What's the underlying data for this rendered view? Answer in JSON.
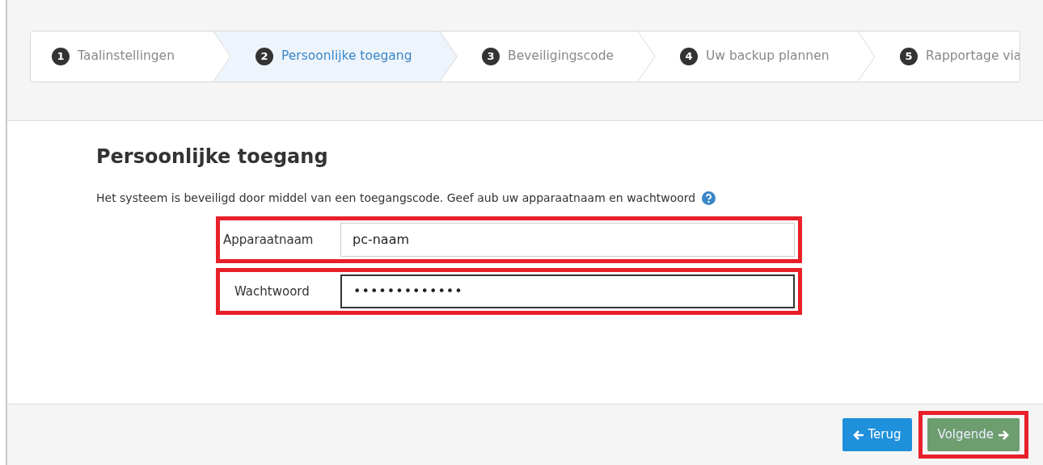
{
  "steps": [
    {
      "number": "1",
      "label": "Taalinstellingen",
      "selected": false
    },
    {
      "number": "2",
      "label": "Persoonlijke toegang",
      "selected": true
    },
    {
      "number": "3",
      "label": "Beveiligingscode",
      "selected": false
    },
    {
      "number": "4",
      "label": "Uw backup plannen",
      "selected": false
    },
    {
      "number": "5",
      "label": "Rapportage via",
      "selected": false
    }
  ],
  "heading": "Persoonlijke toegang",
  "intro": "Het systeem is beveiligd door middel van een toegangscode. Geef aub uw apparaatnaam en wachtwoord",
  "fields": [
    {
      "label": "Apparaatnaam",
      "value": "pc-naam",
      "focused": false
    },
    {
      "label": "Wachtwoord",
      "value": "•••••••••••••",
      "focused": true
    }
  ],
  "buttons": [
    {
      "label": "Terug",
      "kind": "back",
      "highlighted": false
    },
    {
      "label": "Volgende",
      "kind": "next",
      "highlighted": true
    }
  ]
}
